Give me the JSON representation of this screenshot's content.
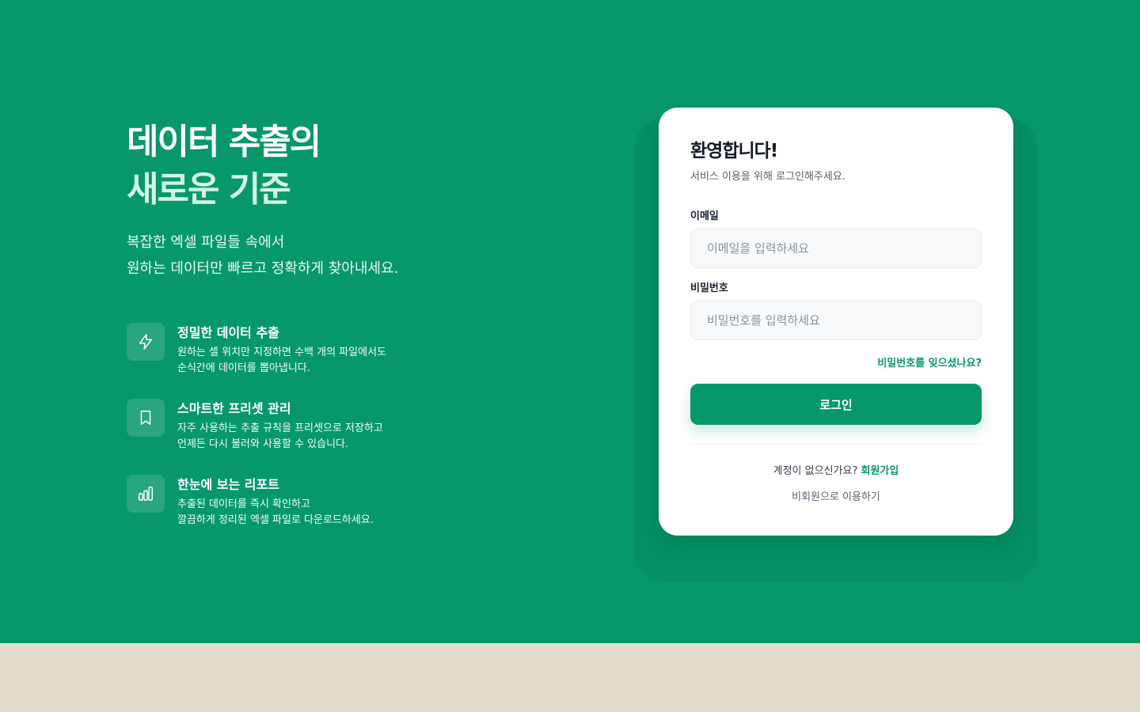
{
  "hero": {
    "headline_line1": "데이터 추출의",
    "headline_line2": "새로운 기준",
    "subtitle_line1": "복잡한 엑셀 파일들 속에서",
    "subtitle_line2": "원하는 데이터만 빠르고 정확하게 찾아내세요."
  },
  "features": [
    {
      "icon": "lightning-icon",
      "title": "정밀한 데이터 추출",
      "desc_line1": "원하는 셀 위치만 지정하면 수백 개의 파일에서도",
      "desc_line2": "순식간에 데이터를 뽑아냅니다."
    },
    {
      "icon": "bookmark-icon",
      "title": "스마트한 프리셋 관리",
      "desc_line1": "자주 사용하는 추출 규칙을 프리셋으로 저장하고",
      "desc_line2": "언제든 다시 불러와 사용할 수 있습니다."
    },
    {
      "icon": "bar-chart-icon",
      "title": "한눈에 보는 리포트",
      "desc_line1": "추출된 데이터를 즉시 확인하고",
      "desc_line2": "깔끔하게 정리된 엑셀 파일로 다운로드하세요."
    }
  ],
  "login": {
    "title": "환영합니다!",
    "subtitle": "서비스 이용을 위해 로그인해주세요.",
    "email_label": "이메일",
    "email_placeholder": "이메일을 입력하세요",
    "email_value": "",
    "password_label": "비밀번호",
    "password_placeholder": "비밀번호를 입력하세요",
    "password_value": "",
    "forgot_label": "비밀번호를 잊으셨나요?",
    "submit_label": "로그인",
    "no_account_text": "계정이 없으신가요?",
    "signup_label": "회원가입",
    "guest_label": "비회원으로 이용하기"
  },
  "colors": {
    "brand": "#06986b",
    "footer_bg": "#e3dccd",
    "card_bg": "#ffffff"
  }
}
